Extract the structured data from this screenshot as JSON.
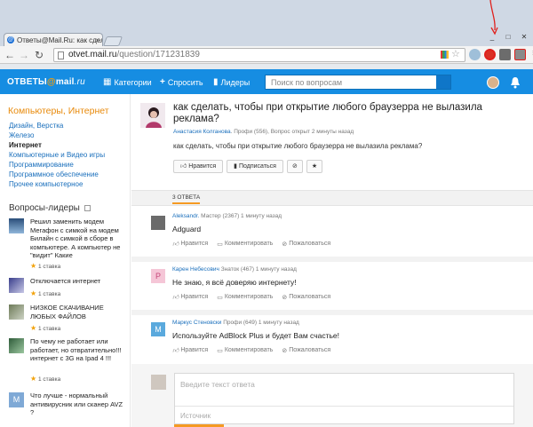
{
  "browser": {
    "tab_title": "Ответы@Mail.Ru: как сдела",
    "tab_favicon": "@",
    "url_host": "otvet.mail.ru",
    "url_path": "/question/171231839",
    "window_controls": [
      "_",
      "□",
      "✕"
    ]
  },
  "header": {
    "logo": {
      "left": "ОТВЕТЫ",
      "at": "@",
      "mail": "mail",
      "ru": ".ru"
    },
    "nav": [
      {
        "label": "Категории",
        "icon": "grid-icon"
      },
      {
        "label": "Спросить",
        "icon": "plus-icon"
      },
      {
        "label": "Лидеры",
        "icon": "bars-icon"
      }
    ],
    "search_placeholder": "Поиск по вопросам"
  },
  "sidebar": {
    "category_title": "Компьютеры, Интернет",
    "categories": [
      {
        "label": "Дизайн, Верстка",
        "active": false
      },
      {
        "label": "Железо",
        "active": false
      },
      {
        "label": "Интернет",
        "active": true
      },
      {
        "label": "Компьютерные и Видео игры",
        "active": false
      },
      {
        "label": "Программирование",
        "active": false
      },
      {
        "label": "Программное обеспечение",
        "active": false
      },
      {
        "label": "Прочее компьютерное",
        "active": false
      }
    ],
    "leaders_title": "Вопросы-лидеры",
    "leaders": [
      {
        "question": "Решил заменить модем Мегафон с симкой на модем Билайн с симкой в сборе в компьютере. А компьютер не \"видит\" Какие",
        "stake": "1 ставка"
      },
      {
        "question": "Отключается интернет",
        "stake": "1 ставка"
      },
      {
        "question": "НИЗКОЕ СКАЧИВАНИЕ ЛЮБЫХ ФАЙЛОВ",
        "stake": "1 ставка"
      },
      {
        "question": "По чему не работает или работает, но отвратительно!!! интернет с 3G на Ipad 4 !!!",
        "stake": "1 ставка"
      },
      {
        "question": "Что лучше - нормальный антивирусник или сканер AVZ ?",
        "stake": "1 ставка"
      }
    ]
  },
  "question": {
    "title": "как сделать, чтобы при открытие любого браузерра не вылазила реклама?",
    "author": "Анастасия Колганова",
    "meta_rest": ". Профи (556), Вопрос открыт 2 минуты назад",
    "body": "как сделать, чтобы при открытие любого браузерра не вылазила реклама?",
    "actions": {
      "like": "Нравится",
      "subscribe": "Подписаться"
    }
  },
  "answers_tab": "3 ОТВЕТА",
  "answers": [
    {
      "author": "Aleksandr.",
      "meta": " Мастер (2367) 1 минуту назад",
      "text": "Adguard",
      "avatar_letter": "",
      "avatar_color": "#6b6b6b"
    },
    {
      "author": "Карен Небесович",
      "meta": " Знаток (467) 1 минуту назад",
      "text": "Не знаю, я всё доверяю интернету!",
      "avatar_letter": "Р",
      "avatar_color": "#f5c6d7"
    },
    {
      "author": "Маркус Стеновски",
      "meta": " Профи (649) 1 минуту назад",
      "text": "Используйте AdBlock Plus и будет Вам счастье!",
      "avatar_letter": "М",
      "avatar_color": "#5aa9dd"
    }
  ],
  "answer_actions": {
    "like": "Нравится",
    "comment": "Комментировать",
    "report": "Пожаловаться"
  },
  "reply": {
    "placeholder": "Введите текст ответа",
    "source_placeholder": "Источник"
  },
  "colors": {
    "header": "#168de2",
    "accent": "#f59a23",
    "link": "#1a6fbc"
  }
}
